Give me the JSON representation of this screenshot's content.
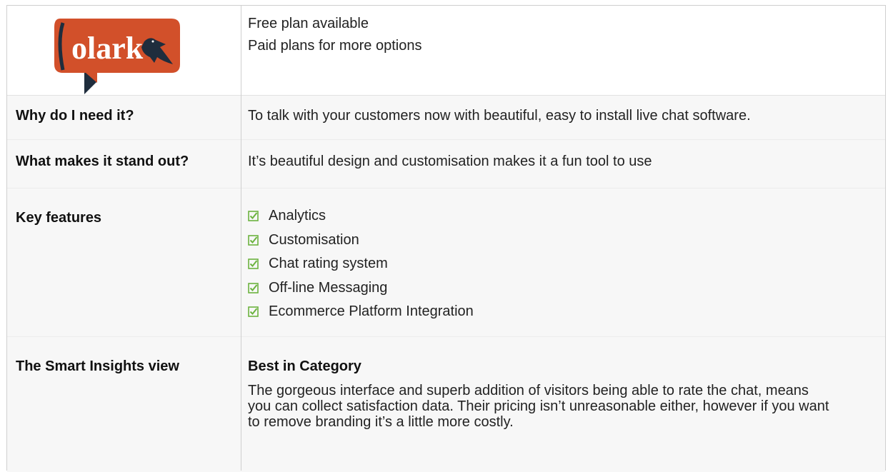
{
  "logo": {
    "text": "olark",
    "icon": "olark-bird-speech-bubble-logo"
  },
  "plans": [
    "Free plan available",
    "Paid plans for more options"
  ],
  "rows": {
    "need": {
      "label": "Why do I need it?",
      "value": "To talk with your customers now with beautiful, easy to install live chat software."
    },
    "stand": {
      "label": "What makes it stand out?",
      "value": "It’s beautiful design and customisation makes it a fun tool to use"
    },
    "features": {
      "label": "Key features",
      "icon": "checkbox-checked-icon",
      "items": [
        "Analytics",
        "Customisation",
        "Chat rating system",
        "Off-line Messaging",
        "Ecommerce Platform Integration"
      ]
    },
    "view": {
      "label": "The Smart Insights view",
      "heading": "Best in Category",
      "text": "The gorgeous interface and superb addition of visitors being able to rate the chat, means you can collect satisfaction data. Their pricing isn’t unreasonable either, however if you want to remove branding it’s a little more costly."
    }
  },
  "colors": {
    "logo_orange": "#d2502a",
    "logo_dark": "#1f2d3d",
    "check_green": "#6cb33f",
    "row_bg": "#f7f7f7",
    "border": "#cfcfcf"
  }
}
